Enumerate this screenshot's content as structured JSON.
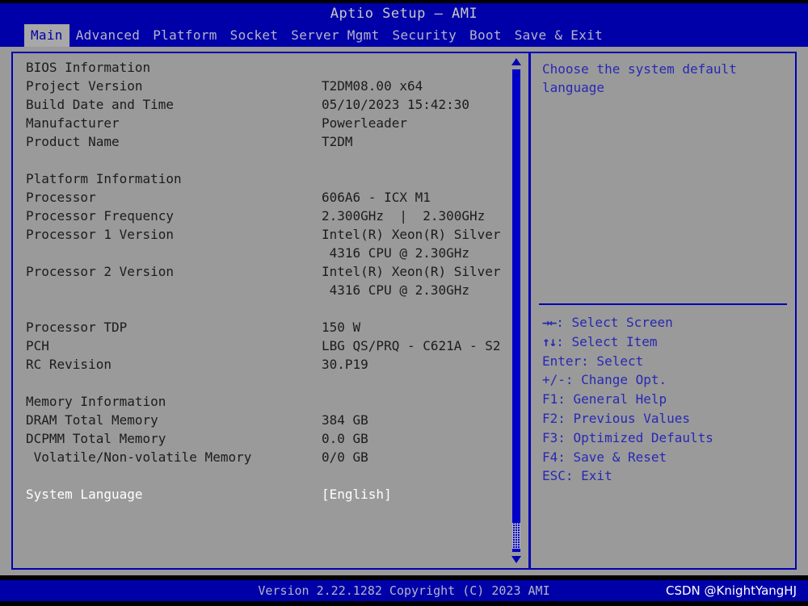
{
  "window": {
    "title": "Aptio Setup – AMI"
  },
  "menubar": {
    "tabs": [
      {
        "label": "Main",
        "active": true
      },
      {
        "label": "Advanced",
        "active": false
      },
      {
        "label": "Platform",
        "active": false
      },
      {
        "label": "Socket",
        "active": false
      },
      {
        "label": "Server Mgmt",
        "active": false
      },
      {
        "label": "Security",
        "active": false
      },
      {
        "label": "Boot",
        "active": false
      },
      {
        "label": "Save & Exit",
        "active": false
      }
    ]
  },
  "main": {
    "rows": [
      {
        "label": "BIOS Information",
        "value": "",
        "kind": "heading"
      },
      {
        "label": "Project Version",
        "value": "T2DM08.00 x64",
        "kind": "info"
      },
      {
        "label": "Build Date and Time",
        "value": "05/10/2023 15:42:30",
        "kind": "info"
      },
      {
        "label": "Manufacturer",
        "value": "Powerleader",
        "kind": "info"
      },
      {
        "label": "Product Name",
        "value": "T2DM",
        "kind": "info"
      },
      {
        "label": "",
        "value": "",
        "kind": "spacer"
      },
      {
        "label": "Platform Information",
        "value": "",
        "kind": "heading"
      },
      {
        "label": "Processor",
        "value": "606A6 - ICX M1",
        "kind": "info"
      },
      {
        "label": "Processor Frequency",
        "value": "2.300GHz  |  2.300GHz",
        "kind": "info"
      },
      {
        "label": "Processor 1 Version",
        "value": "Intel(R) Xeon(R) Silver",
        "kind": "info"
      },
      {
        "label": "",
        "value": " 4316 CPU @ 2.30GHz",
        "kind": "info"
      },
      {
        "label": "Processor 2 Version",
        "value": "Intel(R) Xeon(R) Silver",
        "kind": "info"
      },
      {
        "label": "",
        "value": " 4316 CPU @ 2.30GHz",
        "kind": "info"
      },
      {
        "label": "",
        "value": "",
        "kind": "spacer"
      },
      {
        "label": "Processor TDP",
        "value": "150 W",
        "kind": "info"
      },
      {
        "label": "PCH",
        "value": "LBG QS/PRQ - C621A - S2",
        "kind": "info"
      },
      {
        "label": "RC Revision",
        "value": "30.P19",
        "kind": "info"
      },
      {
        "label": "",
        "value": "",
        "kind": "spacer"
      },
      {
        "label": "Memory Information",
        "value": "",
        "kind": "heading"
      },
      {
        "label": "DRAM Total Memory",
        "value": "384 GB",
        "kind": "info"
      },
      {
        "label": "DCPMM Total Memory",
        "value": "0.0 GB",
        "kind": "info"
      },
      {
        "label": " Volatile/Non-volatile Memory",
        "value": "0/0 GB",
        "kind": "info"
      },
      {
        "label": "",
        "value": "",
        "kind": "spacer"
      },
      {
        "label": "System Language",
        "value": "[English]",
        "kind": "selected"
      }
    ]
  },
  "help": {
    "description": "Choose the system default\nlanguage",
    "hotkeys": [
      {
        "glyph": "→←",
        "text": ": Select Screen"
      },
      {
        "glyph": "↑↓",
        "text": ": Select Item"
      },
      {
        "glyph": "",
        "text": "Enter: Select"
      },
      {
        "glyph": "",
        "text": "+/-: Change Opt."
      },
      {
        "glyph": "",
        "text": "F1: General Help"
      },
      {
        "glyph": "",
        "text": "F2: Previous Values"
      },
      {
        "glyph": "",
        "text": "F3: Optimized Defaults"
      },
      {
        "glyph": "",
        "text": "F4: Save & Reset"
      },
      {
        "glyph": "",
        "text": "ESC: Exit"
      }
    ]
  },
  "footer": {
    "version": "Version 2.22.1282 Copyright (C) 2023 AMI",
    "watermark": "CSDN @KnightYangHJ"
  },
  "colors": {
    "background": "#000000",
    "bar_blue": "#0000a8",
    "panel_gray": "#9a9a9a",
    "border_blue": "#0000b4",
    "help_text": "#2828b4",
    "body_text": "#1c1c1c",
    "selected_text": "#ffffff",
    "bar_text": "#b4b4c8",
    "active_tab_bg": "#a8a8a8"
  }
}
